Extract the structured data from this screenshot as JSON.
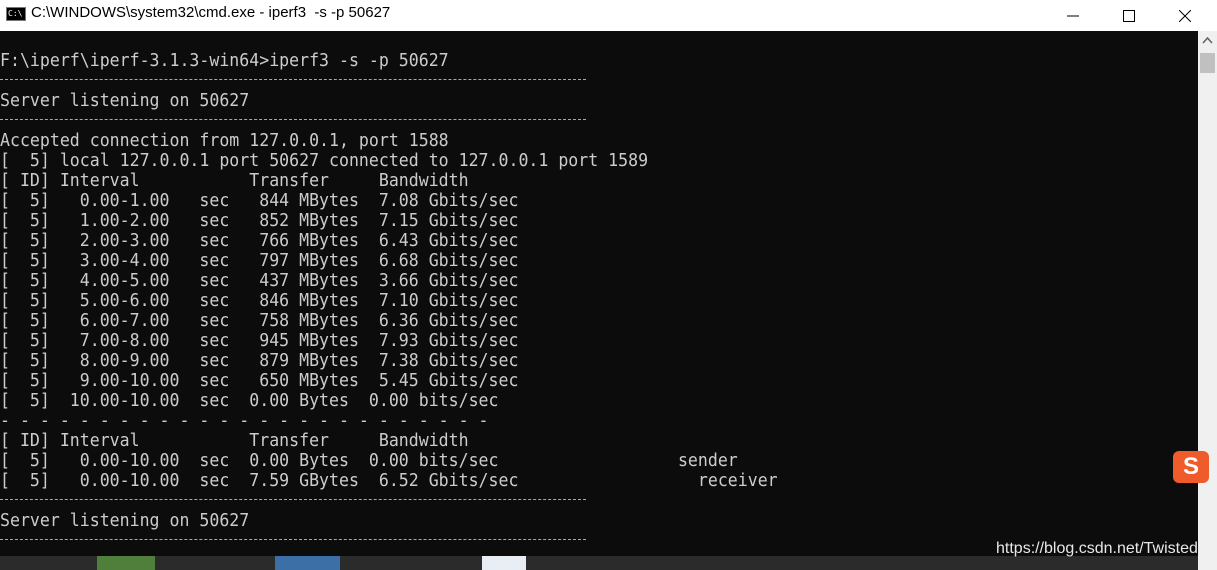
{
  "window": {
    "title": "C:\\WINDOWS\\system32\\cmd.exe - iperf3  -s -p 50627",
    "icon_text": "C:\\"
  },
  "console": {
    "lines": [
      "F:\\iperf\\iperf-3.1.3-win64>iperf3 -s -p 50627",
      "",
      "Server listening on 50627",
      "",
      "Accepted connection from 127.0.0.1, port 1588",
      "[  5] local 127.0.0.1 port 50627 connected to 127.0.0.1 port 1589",
      "[ ID] Interval           Transfer     Bandwidth",
      "[  5]   0.00-1.00   sec   844 MBytes  7.08 Gbits/sec",
      "[  5]   1.00-2.00   sec   852 MBytes  7.15 Gbits/sec",
      "[  5]   2.00-3.00   sec   766 MBytes  6.43 Gbits/sec",
      "[  5]   3.00-4.00   sec   797 MBytes  6.68 Gbits/sec",
      "[  5]   4.00-5.00   sec   437 MBytes  3.66 Gbits/sec",
      "[  5]   5.00-6.00   sec   846 MBytes  7.10 Gbits/sec",
      "[  5]   6.00-7.00   sec   758 MBytes  6.36 Gbits/sec",
      "[  5]   7.00-8.00   sec   945 MBytes  7.93 Gbits/sec",
      "[  5]   8.00-9.00   sec   879 MBytes  7.38 Gbits/sec",
      "[  5]   9.00-10.00  sec   650 MBytes  5.45 Gbits/sec",
      "[  5]  10.00-10.00  sec  0.00 Bytes  0.00 bits/sec",
      "- - - - - - - - - - - - - - - - - - - - - - - - -",
      "[ ID] Interval           Transfer     Bandwidth",
      "[  5]   0.00-10.00  sec  0.00 Bytes  0.00 bits/sec                  sender",
      "[  5]   0.00-10.00  sec  7.59 GBytes  6.52 Gbits/sec                  receiver",
      "",
      "Server listening on 50627",
      ""
    ]
  },
  "ime": {
    "label": "S"
  },
  "watermark": "https://blog.csdn.net/Twisted",
  "colors": {
    "console_bg": "#0c0c0c",
    "console_text": "#cccccc",
    "ime_orange": "#ef5b2b"
  }
}
